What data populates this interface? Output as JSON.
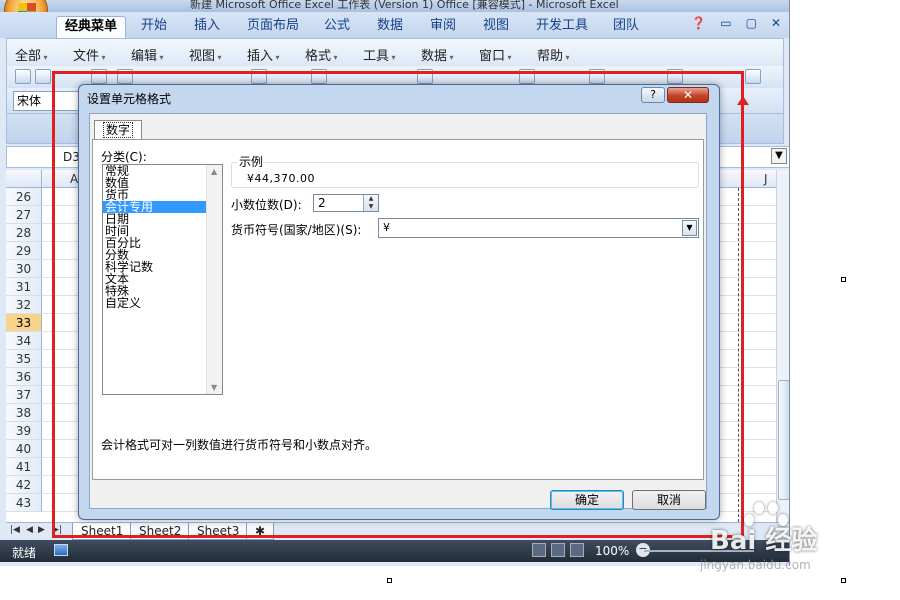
{
  "window": {
    "title_partial": "新建 Microsoft Office Excel 工作表 (Version 1) Office [兼容模式] - Microsoft Excel"
  },
  "ribbon_tabs": [
    "经典菜单",
    "开始",
    "插入",
    "页面布局",
    "公式",
    "数据",
    "审阅",
    "视图",
    "开发工具",
    "团队"
  ],
  "menu": [
    "全部",
    "文件",
    "编辑",
    "视图",
    "插入",
    "格式",
    "工具",
    "数据",
    "窗口",
    "帮助"
  ],
  "font_box": "宋体",
  "name_box": "D3",
  "columns": {
    "first": "A",
    "last": "J"
  },
  "row_numbers": [
    "26",
    "27",
    "28",
    "29",
    "30",
    "31",
    "32",
    "33",
    "34",
    "35",
    "36",
    "37",
    "38",
    "39",
    "40",
    "41",
    "42",
    "43"
  ],
  "selected_row": "33",
  "sheets": [
    "Sheet1",
    "Sheet2",
    "Sheet3"
  ],
  "status": {
    "ready": "就绪",
    "zoom": "100%"
  },
  "dialog": {
    "title": "设置单元格格式",
    "help": "?",
    "tab": "数字",
    "category_label": "分类(C):",
    "categories": [
      "常规",
      "数值",
      "货币",
      "会计专用",
      "日期",
      "时间",
      "百分比",
      "分数",
      "科学记数",
      "文本",
      "特殊",
      "自定义"
    ],
    "selected_category": "会计专用",
    "sample_label": "示例",
    "sample_value": "¥44,370.00",
    "decimal_label": "小数位数(D):",
    "decimal_value": "2",
    "currency_label": "货币符号(国家/地区)(S):",
    "currency_value": "¥",
    "description": "会计格式可对一列数值进行货币符号和小数点对齐。",
    "ok": "确定",
    "cancel": "取消"
  },
  "watermark": {
    "main": "Bai 经验",
    "sub": "jingyan.baidu.com"
  },
  "colors": {
    "annotation_red": "#e02020",
    "selected_blue": "#3399ff",
    "selected_row": "#f8d38a"
  }
}
